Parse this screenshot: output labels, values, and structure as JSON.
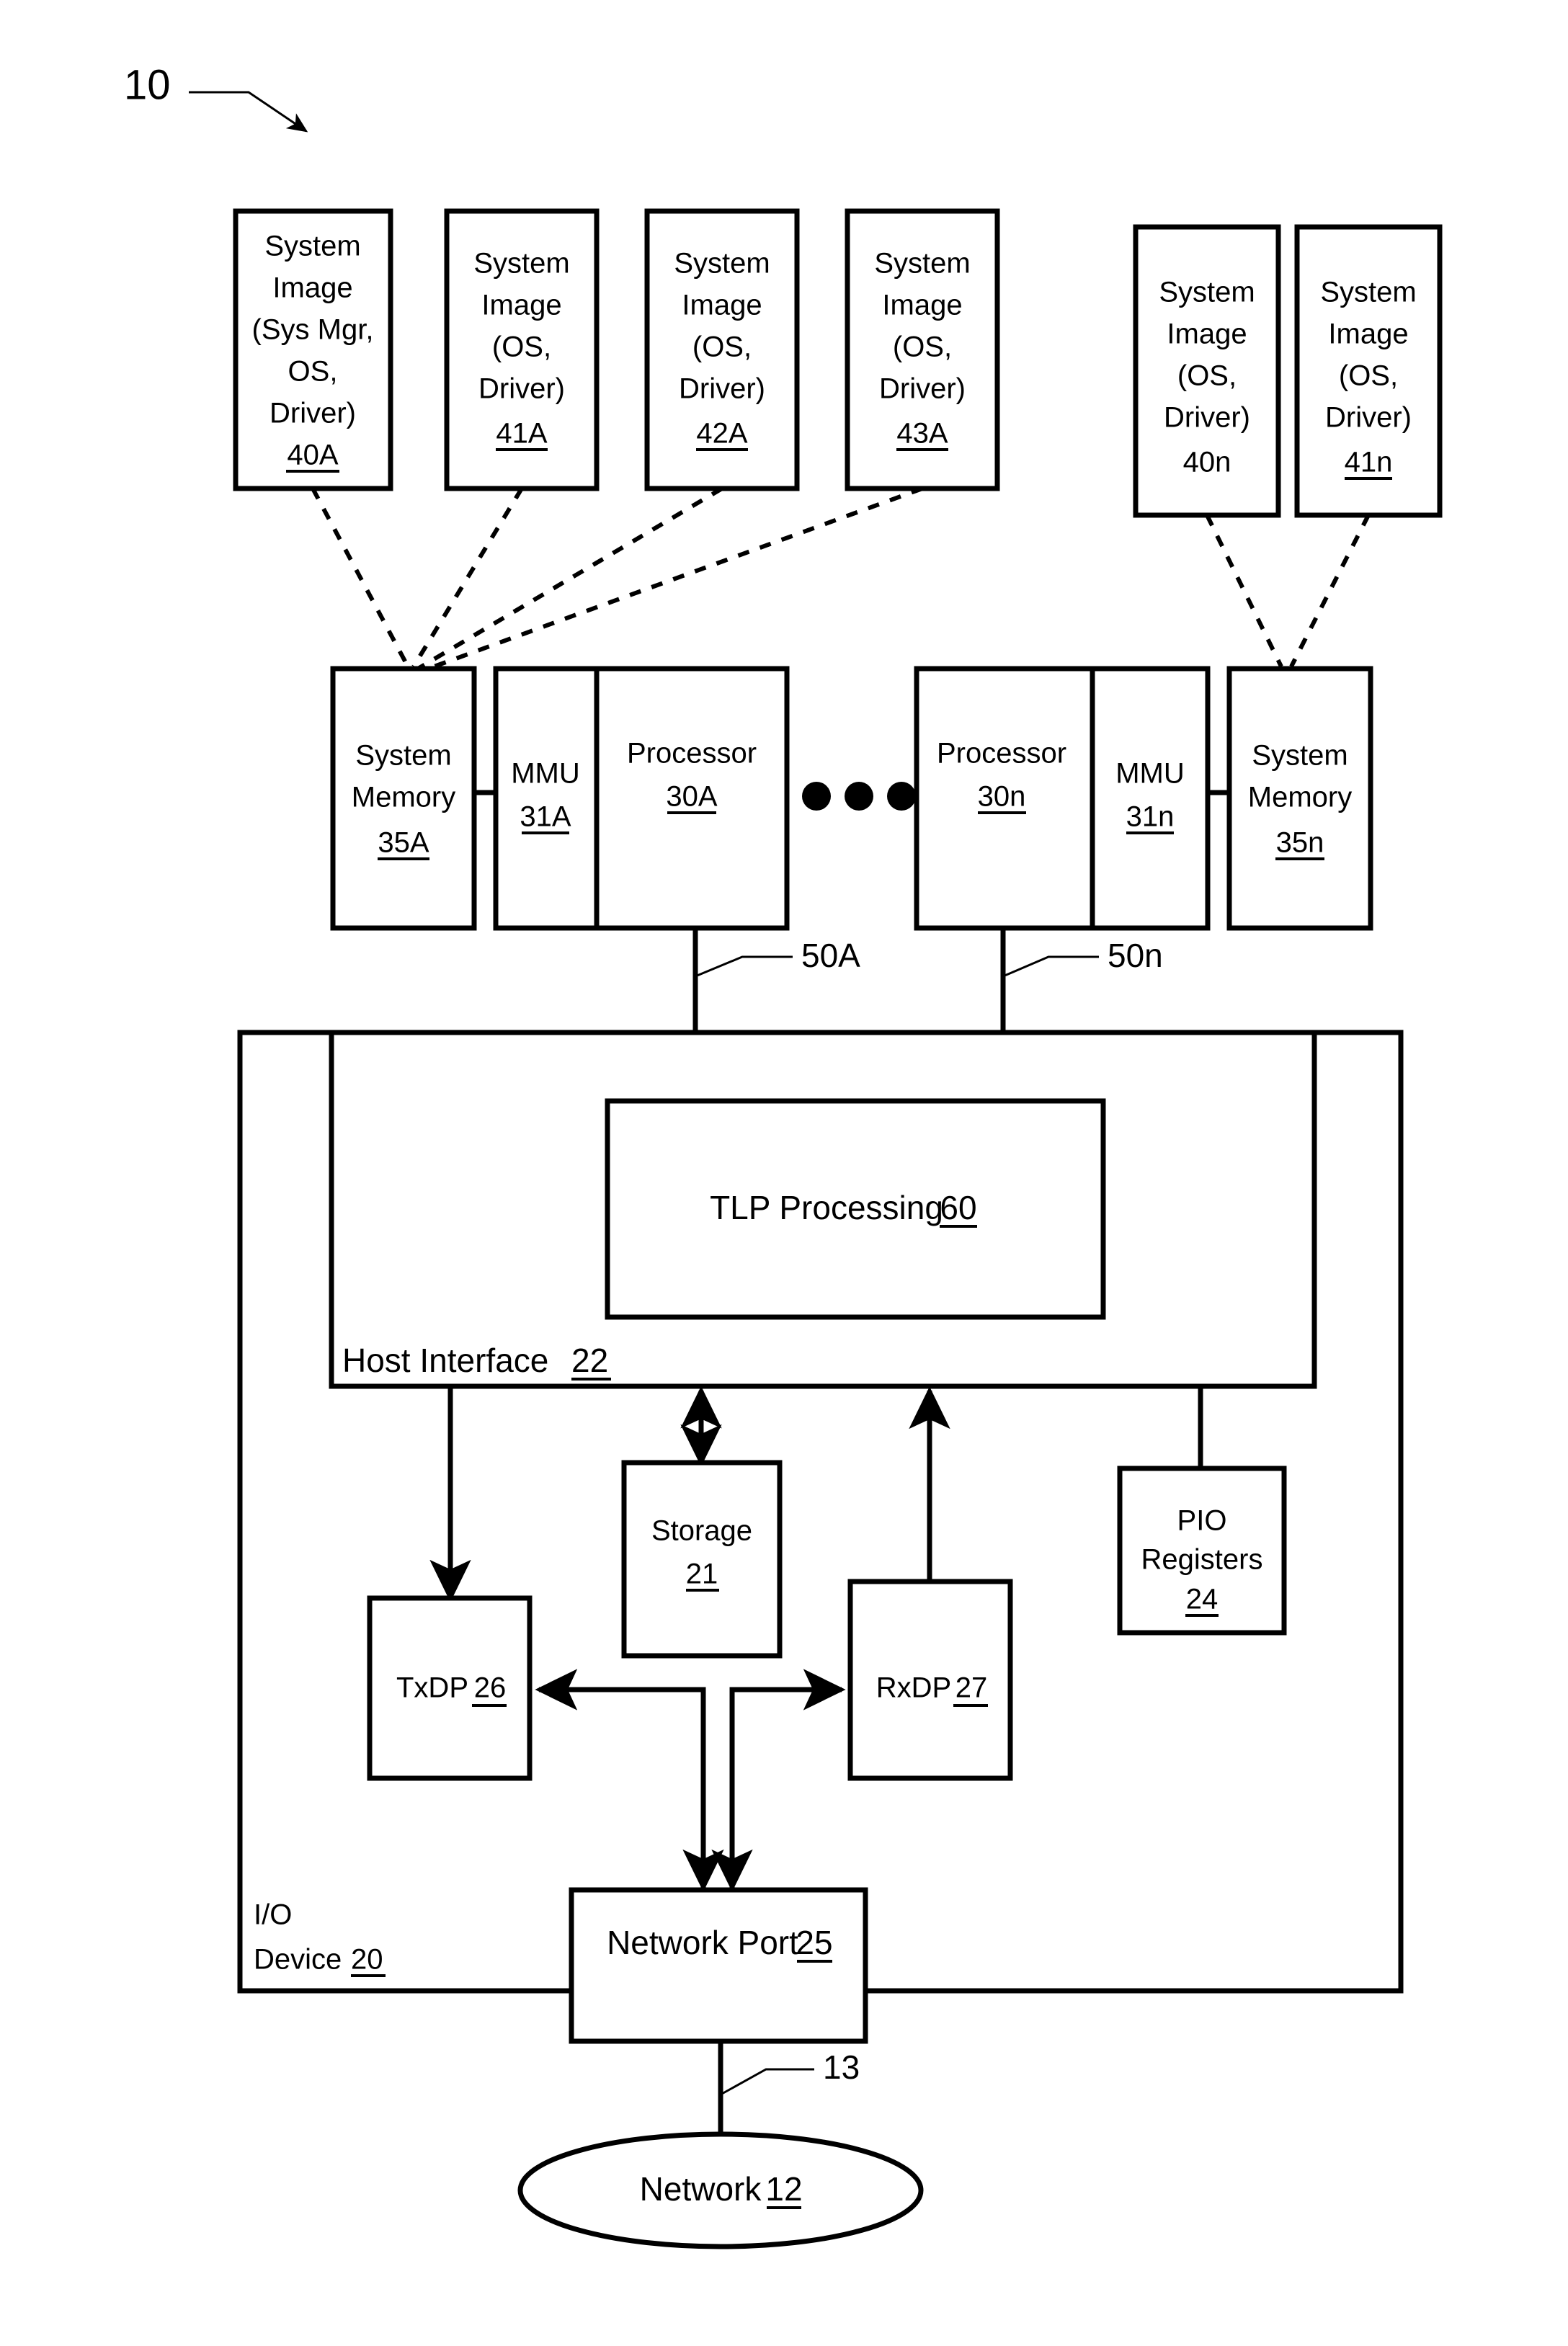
{
  "figure": {
    "figure_ref": "10",
    "title_text": ""
  },
  "system_images_left": [
    {
      "id": "40A",
      "line1": "System",
      "line2": "Image",
      "line3": "(Sys Mgr,",
      "line4": "OS,",
      "line5": "Driver)",
      "ref": "40A",
      "ref_underlined": true
    },
    {
      "id": "41A",
      "line1": "System",
      "line2": "Image",
      "line3": "(OS,",
      "line4": "Driver)",
      "ref": "41A",
      "ref_underlined": true
    },
    {
      "id": "42A",
      "line1": "System",
      "line2": "Image",
      "line3": "(OS,",
      "line4": "Driver)",
      "ref": "42A",
      "ref_underlined": true
    },
    {
      "id": "43A",
      "line1": "System",
      "line2": "Image",
      "line3": "(OS,",
      "line4": "Driver)",
      "ref": "43A",
      "ref_underlined": true
    }
  ],
  "system_images_right": [
    {
      "id": "40n",
      "line1": "System",
      "line2": "Image",
      "line3": "(OS,",
      "line4": "Driver)",
      "ref": "40n",
      "ref_underlined": false
    },
    {
      "id": "41n",
      "line1": "System",
      "line2": "Image",
      "line3": "(OS,",
      "line4": "Driver)",
      "ref": "41n",
      "ref_underlined": true
    }
  ],
  "host_row": {
    "memory_a": {
      "line1": "System",
      "line2": "Memory",
      "ref": "35A"
    },
    "mmu_a": {
      "label": "MMU",
      "ref": "31A"
    },
    "processor_a": {
      "label": "Processor",
      "ref": "30A"
    },
    "ellipsis": "● ● ●",
    "processor_n": {
      "label": "Processor",
      "ref": "30n"
    },
    "mmu_n": {
      "label": "MMU",
      "ref": "31n"
    },
    "memory_n": {
      "line1": "System",
      "line2": "Memory",
      "ref": "35n"
    }
  },
  "bus_labels": {
    "bus_a": "50A",
    "bus_n": "50n",
    "network_link": "13"
  },
  "io_device": {
    "label_line1": "I/O",
    "label_line2": "Device",
    "ref": "20",
    "host_interface": {
      "label": "Host Interface",
      "ref": "22",
      "tlp": {
        "label": "TLP Processing",
        "ref": "60"
      }
    },
    "storage": {
      "label": "Storage",
      "ref": "21"
    },
    "pio": {
      "line1": "PIO",
      "line2": "Registers",
      "ref": "24"
    },
    "txdp": {
      "label": "TxDP",
      "ref": "26"
    },
    "rxdp": {
      "label": "RxDP",
      "ref": "27"
    },
    "network_port": {
      "label": "Network Port",
      "ref": "25"
    }
  },
  "network": {
    "label": "Network",
    "ref": "12"
  },
  "colors": {
    "stroke": "#000000",
    "fill": "#ffffff",
    "text": "#000000"
  }
}
